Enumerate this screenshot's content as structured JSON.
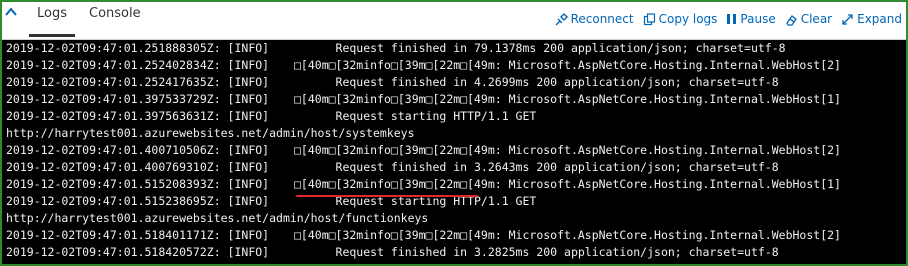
{
  "tabs": [
    {
      "label": "Logs",
      "active": true
    },
    {
      "label": "Console",
      "active": false
    }
  ],
  "actions": [
    {
      "label": "Reconnect",
      "icon": "reconnect-icon"
    },
    {
      "label": "Copy logs",
      "icon": "copy-icon"
    },
    {
      "label": "Pause",
      "icon": "pause-icon"
    },
    {
      "label": "Clear",
      "icon": "clear-icon"
    },
    {
      "label": "Expand",
      "icon": "expand-icon"
    }
  ],
  "colors": {
    "accent": "#0067b8",
    "border": "#2e8b2e",
    "console_bg": "#000000",
    "highlight": "#e3262c"
  },
  "log_lines": [
    {
      "ts": "2019-12-02T09:47:01.251888305Z: [INFO]",
      "msg": "      Request finished in 79.1378ms 200 application/json; charset=utf-8"
    },
    {
      "ts": "2019-12-02T09:47:01.252402834Z: [INFO]",
      "msg": "□[40m□[32minfo□[39m□[22m□[49m: Microsoft.AspNetCore.Hosting.Internal.WebHost[2]"
    },
    {
      "ts": "2019-12-02T09:47:01.252417635Z: [INFO]",
      "msg": "      Request finished in 4.2699ms 200 application/json; charset=utf-8"
    },
    {
      "ts": "2019-12-02T09:47:01.397533729Z: [INFO]",
      "msg": "□[40m□[32minfo□[39m□[22m□[49m: Microsoft.AspNetCore.Hosting.Internal.WebHost[1]"
    },
    {
      "ts": "2019-12-02T09:47:01.397563631Z: [INFO]",
      "msg": "      Request starting HTTP/1.1 GET"
    },
    {
      "ts": "",
      "msg": "http://harrytest001.azurewebsites.net/admin/host/systemkeys",
      "url": true
    },
    {
      "ts": "2019-12-02T09:47:01.400710506Z: [INFO]",
      "msg": "□[40m□[32minfo□[39m□[22m□[49m: Microsoft.AspNetCore.Hosting.Internal.WebHost[2]"
    },
    {
      "ts": "2019-12-02T09:47:01.400769310Z: [INFO]",
      "msg": "      Request finished in 3.2643ms 200 application/json; charset=utf-8"
    },
    {
      "ts": "2019-12-02T09:47:01.515208393Z: [INFO]",
      "msg": "□[40m□[32minfo□[39m□[22m□[49m: Microsoft.AspNetCore.Hosting.Internal.WebHost[1]"
    },
    {
      "ts": "2019-12-02T09:47:01.515238695Z: [INFO]",
      "msg": "      Request starting HTTP/1.1 GET"
    },
    {
      "ts": "",
      "msg": "http://harrytest001.azurewebsites.net/admin/host/functionkeys",
      "url": true
    },
    {
      "ts": "2019-12-02T09:47:01.518401171Z: [INFO]",
      "msg": "□[40m□[32minfo□[39m□[22m□[49m: Microsoft.AspNetCore.Hosting.Internal.WebHost[2]"
    },
    {
      "ts": "2019-12-02T09:47:01.518420572Z: [INFO]",
      "msg": "      Request finished in 3.2825ms 200 application/json; charset=utf-8"
    }
  ]
}
